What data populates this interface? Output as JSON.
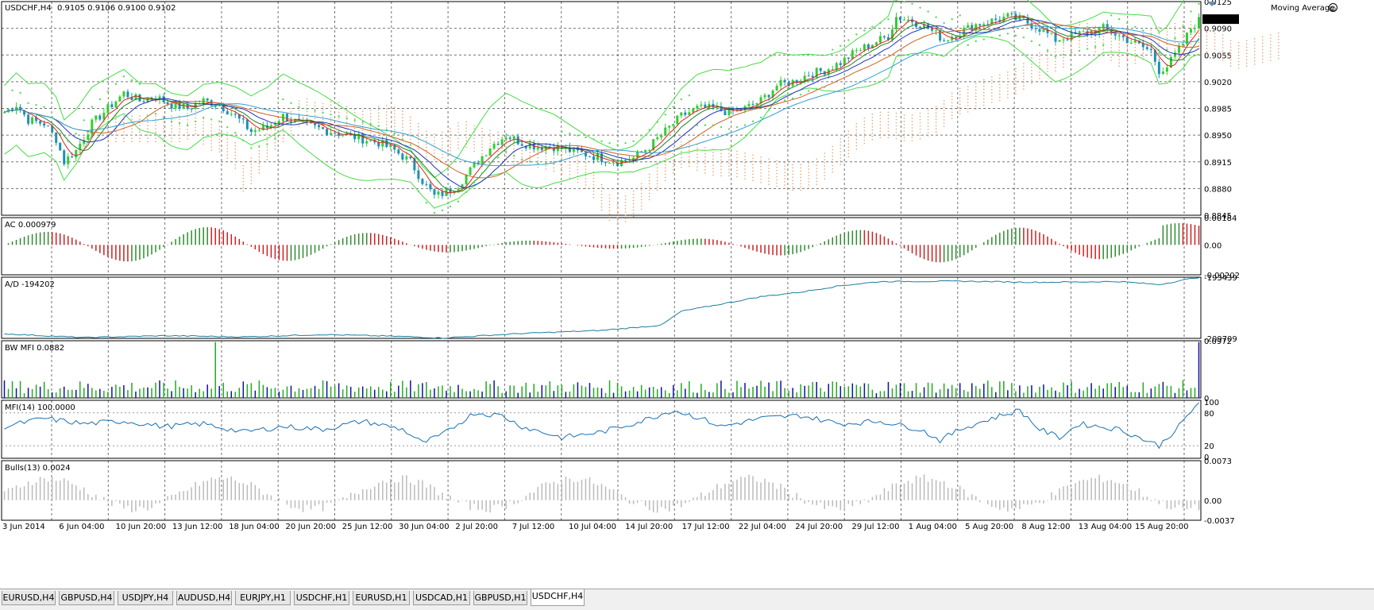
{
  "window": {
    "symbol_label": "USDCHF,H4",
    "ohlc": "0.9105 0.9106 0.9100 0.9102"
  },
  "indicator_name": "Moving Average",
  "colors": {
    "bull": "#32cd32",
    "bear": "#1e90b4",
    "ac_up": "#2e8b2e",
    "ac_down": "#cc2020",
    "ad": "#1e7e9e",
    "mfi": "#1a6fb0",
    "bw_blue": "#1010a0",
    "bw_green": "#22aa22",
    "bulls": "#bbbbbb",
    "grid": "#000000"
  },
  "panes": [
    {
      "id": "price",
      "title": "",
      "ticks": [
        "0.9125",
        "0.9090",
        "0.9055",
        "0.9020",
        "0.8985",
        "0.8950",
        "0.8915",
        "0.8880",
        "0.8845"
      ],
      "current": "0.9102"
    },
    {
      "id": "ac",
      "title": "AC 0.000979",
      "ticks": [
        "0.00184",
        "0.00",
        "-0.00202"
      ]
    },
    {
      "id": "ad",
      "title": "A/D -194202",
      "ticks": [
        "-193439",
        "-209709"
      ]
    },
    {
      "id": "bwmfi",
      "title": "BW MFI 0.0882",
      "ticks": [
        "0.0972",
        "0"
      ]
    },
    {
      "id": "mfi",
      "title": "MFI(14) 100.0000",
      "ticks": [
        "100",
        "80",
        "20",
        "0"
      ]
    },
    {
      "id": "bulls",
      "title": "Bulls(13) 0.0024",
      "ticks": [
        "0.0073",
        "0.00",
        "-0.0037"
      ]
    }
  ],
  "time_axis": [
    "3 Jun 2014",
    "6 Jun 04:00",
    "10 Jun 20:00",
    "13 Jun 12:00",
    "18 Jun 04:00",
    "20 Jun 20:00",
    "25 Jun 12:00",
    "30 Jun 04:00",
    "2 Jul 20:00",
    "7 Jul 12:00",
    "10 Jul 04:00",
    "14 Jul 20:00",
    "17 Jul 12:00",
    "22 Jul 04:00",
    "24 Jul 20:00",
    "29 Jul 12:00",
    "1 Aug 04:00",
    "5 Aug 20:00",
    "8 Aug 12:00",
    "13 Aug 04:00",
    "15 Aug 20:00"
  ],
  "tabs": [
    "EURUSD,H4",
    "GBPUSD,H4",
    "USDJPY,H4",
    "AUDUSD,H4",
    "EURJPY,H1",
    "USDCHF,H1",
    "EURUSD,H1",
    "USDCAD,H1",
    "GBPUSD,H1",
    "USDCHF,H4"
  ],
  "active_tab": "USDCHF,H4",
  "chart_data": {
    "type": "line",
    "title": "USDCHF,H4",
    "price_anchors": [
      [
        0,
        0.898
      ],
      [
        3,
        0.899
      ],
      [
        6,
        0.897
      ],
      [
        10,
        0.8965
      ],
      [
        13,
        0.8945
      ],
      [
        15,
        0.8915
      ],
      [
        18,
        0.893
      ],
      [
        22,
        0.8965
      ],
      [
        26,
        0.8985
      ],
      [
        30,
        0.9005
      ],
      [
        34,
        0.8995
      ],
      [
        38,
        0.9
      ],
      [
        42,
        0.899
      ],
      [
        46,
        0.8985
      ],
      [
        50,
        0.8995
      ],
      [
        54,
        0.899
      ],
      [
        58,
        0.8975
      ],
      [
        62,
        0.8955
      ],
      [
        66,
        0.896
      ],
      [
        70,
        0.8975
      ],
      [
        74,
        0.8965
      ],
      [
        78,
        0.896
      ],
      [
        82,
        0.8955
      ],
      [
        86,
        0.895
      ],
      [
        90,
        0.8945
      ],
      [
        94,
        0.894
      ],
      [
        98,
        0.893
      ],
      [
        102,
        0.8915
      ],
      [
        105,
        0.889
      ],
      [
        108,
        0.887
      ],
      [
        111,
        0.8875
      ],
      [
        114,
        0.8885
      ],
      [
        118,
        0.891
      ],
      [
        122,
        0.8935
      ],
      [
        126,
        0.895
      ],
      [
        130,
        0.894
      ],
      [
        134,
        0.8935
      ],
      [
        138,
        0.8935
      ],
      [
        142,
        0.893
      ],
      [
        146,
        0.8925
      ],
      [
        150,
        0.892
      ],
      [
        154,
        0.8915
      ],
      [
        158,
        0.892
      ],
      [
        162,
        0.8935
      ],
      [
        166,
        0.8955
      ],
      [
        170,
        0.8975
      ],
      [
        174,
        0.8985
      ],
      [
        178,
        0.8985
      ],
      [
        182,
        0.898
      ],
      [
        186,
        0.8985
      ],
      [
        190,
        0.8995
      ],
      [
        194,
        0.9015
      ],
      [
        198,
        0.902
      ],
      [
        202,
        0.903
      ],
      [
        206,
        0.9035
      ],
      [
        210,
        0.9045
      ],
      [
        214,
        0.906
      ],
      [
        218,
        0.907
      ],
      [
        222,
        0.908
      ],
      [
        224,
        0.9105
      ],
      [
        228,
        0.91
      ],
      [
        232,
        0.909
      ],
      [
        236,
        0.9075
      ],
      [
        240,
        0.9085
      ],
      [
        244,
        0.9095
      ],
      [
        248,
        0.91
      ],
      [
        252,
        0.9105
      ],
      [
        256,
        0.91
      ],
      [
        260,
        0.909
      ],
      [
        264,
        0.9075
      ],
      [
        268,
        0.908
      ],
      [
        272,
        0.9085
      ],
      [
        276,
        0.909
      ],
      [
        280,
        0.908
      ],
      [
        284,
        0.907
      ],
      [
        288,
        0.906
      ],
      [
        290,
        0.9035
      ],
      [
        292,
        0.904
      ],
      [
        294,
        0.9055
      ],
      [
        296,
        0.907
      ],
      [
        298,
        0.909
      ],
      [
        300,
        0.91
      ]
    ],
    "ad_anchors": [
      [
        0,
        -208500
      ],
      [
        20,
        -209500
      ],
      [
        40,
        -209000
      ],
      [
        60,
        -209300
      ],
      [
        80,
        -208700
      ],
      [
        100,
        -209200
      ],
      [
        110,
        -209600
      ],
      [
        130,
        -208400
      ],
      [
        150,
        -207600
      ],
      [
        165,
        -206200
      ],
      [
        170,
        -202500
      ],
      [
        180,
        -200600
      ],
      [
        190,
        -198600
      ],
      [
        200,
        -197400
      ],
      [
        210,
        -195700
      ],
      [
        220,
        -194600
      ],
      [
        240,
        -194500
      ],
      [
        260,
        -194800
      ],
      [
        280,
        -194600
      ],
      [
        290,
        -195400
      ],
      [
        300,
        -193439
      ]
    ],
    "mfi_anchors": [
      [
        0,
        55
      ],
      [
        10,
        70
      ],
      [
        20,
        60
      ],
      [
        30,
        65
      ],
      [
        40,
        55
      ],
      [
        50,
        60
      ],
      [
        60,
        45
      ],
      [
        70,
        55
      ],
      [
        80,
        50
      ],
      [
        90,
        65
      ],
      [
        100,
        50
      ],
      [
        105,
        25
      ],
      [
        110,
        40
      ],
      [
        118,
        80
      ],
      [
        125,
        75
      ],
      [
        130,
        55
      ],
      [
        140,
        35
      ],
      [
        150,
        45
      ],
      [
        160,
        65
      ],
      [
        168,
        85
      ],
      [
        175,
        70
      ],
      [
        180,
        55
      ],
      [
        190,
        70
      ],
      [
        200,
        75
      ],
      [
        210,
        60
      ],
      [
        220,
        65
      ],
      [
        230,
        50
      ],
      [
        235,
        30
      ],
      [
        240,
        50
      ],
      [
        248,
        70
      ],
      [
        255,
        85
      ],
      [
        260,
        50
      ],
      [
        265,
        35
      ],
      [
        270,
        60
      ],
      [
        280,
        50
      ],
      [
        285,
        35
      ],
      [
        290,
        20
      ],
      [
        295,
        55
      ],
      [
        300,
        100
      ]
    ],
    "bars_total": 301,
    "ylim_price": [
      0.8845,
      0.9125
    ],
    "ylim_ac": [
      -0.00202,
      0.00184
    ],
    "ylim_ad": [
      -209709,
      -193439
    ],
    "ylim_bw": [
      0,
      0.0972
    ],
    "ylim_mfi": [
      0,
      100
    ],
    "ylim_bulls": [
      -0.0037,
      0.0073
    ]
  }
}
